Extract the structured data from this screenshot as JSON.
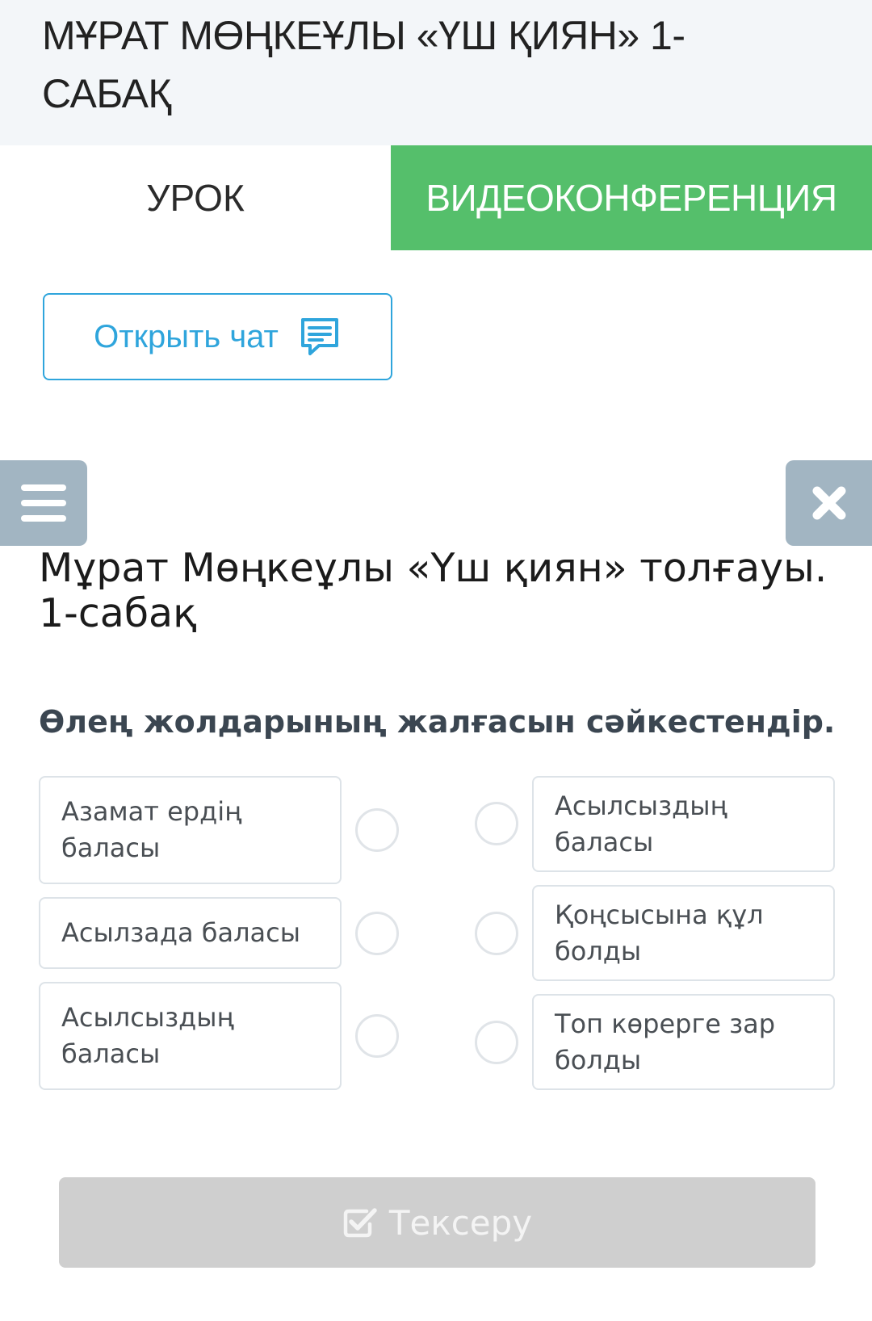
{
  "header": {
    "title": "МҰРАТ МӨҢКЕҰЛЫ «ҮШ ҚИЯН» 1-САБАҚ"
  },
  "tabs": [
    {
      "label": "УРОК",
      "active": true
    },
    {
      "label": "ВИДЕОКОНФЕРЕНЦИЯ",
      "active": false
    }
  ],
  "chat": {
    "label": "Открыть чат",
    "icon": "chat-message-icon"
  },
  "toolbar": {
    "menu_icon": "hamburger-menu-icon",
    "close_icon": "close-icon"
  },
  "lesson": {
    "title": "Мұрат Мөңкеұлы «Үш қиян» толғауы. 1-сабақ",
    "question": "Өлең жолдарының жалғасын сәйкестендір."
  },
  "match": {
    "left": [
      "Азамат ердің баласы",
      "Асылзада баласы",
      "Асылсыздың баласы"
    ],
    "right": [
      "Асылсыздың баласы",
      "Қоңсысына құл болды",
      "Топ көрерге зар болды"
    ]
  },
  "check_button": {
    "label": "Тексеру",
    "icon": "checkbox-check-icon",
    "enabled": false
  },
  "colors": {
    "accent_green": "#55bf6b",
    "accent_blue": "#2fa5dc",
    "side_button": "#a2b5c2",
    "disabled_button": "#cfcfcf"
  }
}
